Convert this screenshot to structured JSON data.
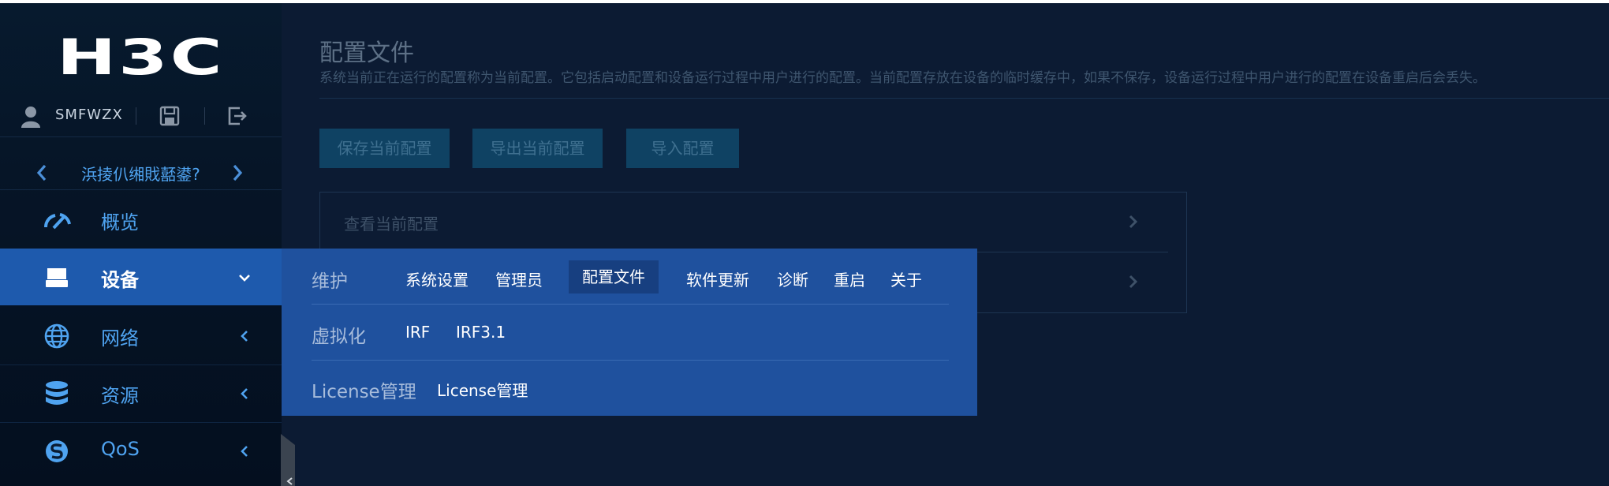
{
  "sidebar": {
    "logo": "H3C",
    "username": "SMFWZX",
    "device_name": "浜掕仈缃戝嚭鍙?",
    "nav": [
      {
        "label": "概览"
      },
      {
        "label": "设备"
      },
      {
        "label": "网络"
      },
      {
        "label": "资源"
      },
      {
        "label": "QoS"
      }
    ]
  },
  "main": {
    "title": "配置文件",
    "description": "系统当前正在运行的配置称为当前配置。它包括启动配置和设备运行过程中用户进行的配置。当前配置存放在设备的临时缓存中，如果不保存，设备运行过程中用户进行的配置在设备重启后会丢失。",
    "buttons": {
      "save": "保存当前配置",
      "export": "导出当前配置",
      "import": "导入配置"
    },
    "panel": {
      "row1": "查看当前配置"
    }
  },
  "flyout": {
    "sections": [
      {
        "title": "维护",
        "links": [
          "系统设置",
          "管理员",
          "配置文件",
          "软件更新",
          "诊断",
          "重启",
          "关于"
        ]
      },
      {
        "title": "虚拟化",
        "links": [
          "IRF",
          "IRF3.1"
        ]
      },
      {
        "title": "License管理",
        "links": [
          "License管理"
        ]
      }
    ],
    "selected": "配置文件"
  },
  "colors": {
    "sidebar_bg": "#061527",
    "accent_blue": "#4fa3f0",
    "active_nav": "#1e5aad",
    "flyout_bg": "#1f519e",
    "main_bg": "#0c1b33"
  }
}
